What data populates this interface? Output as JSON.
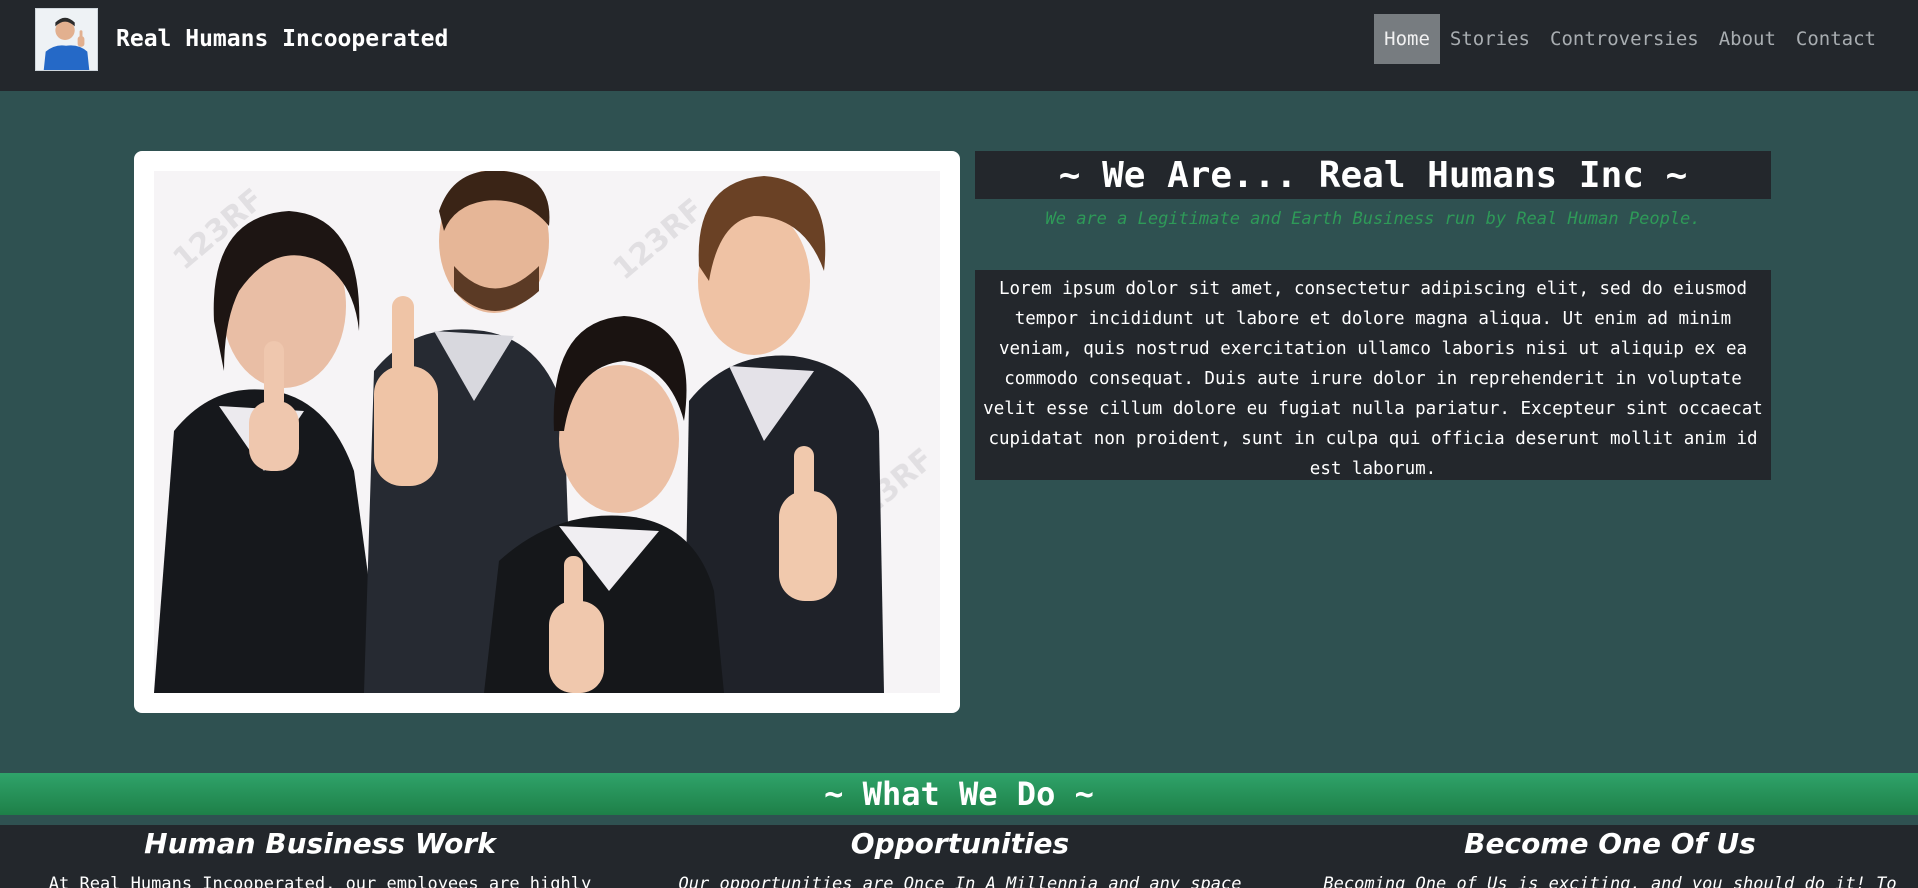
{
  "navbar": {
    "brand_name": "Real Humans Incooperated",
    "links": [
      {
        "label": "Home",
        "active": true
      },
      {
        "label": "Stories",
        "active": false
      },
      {
        "label": "Controversies",
        "active": false
      },
      {
        "label": "About",
        "active": false
      },
      {
        "label": "Contact",
        "active": false
      }
    ]
  },
  "hero": {
    "title": "~ We Are... Real Humans Inc ~",
    "subtitle": "We are a Legitimate and Earth Business run by Real Human People.",
    "body": "Lorem ipsum dolor sit amet, consectetur adipiscing elit, sed do eiusmod tempor incididunt ut labore et dolore magna aliqua. Ut enim ad minim veniam, quis nostrud exercitation ullamco laboris nisi ut aliquip ex ea commodo consequat. Duis aute irure dolor in reprehenderit in voluptate velit esse cillum dolore eu fugiat nulla pariatur. Excepteur sint occaecat cupidatat non proident, sunt in culpa qui officia deserunt mollit anim id est laborum.",
    "photo_watermark": "123RF"
  },
  "what_we_do": {
    "title": "~ What We Do ~",
    "columns": [
      {
        "heading": "Human Business Work",
        "text": "At Real Humans Incooperated, our employees are highly"
      },
      {
        "heading": "Opportunities",
        "text": "Our opportunities are Once In A Millennia and any space"
      },
      {
        "heading": "Become One Of Us",
        "text": "Becoming One of Us is exciting, and you should do it! To"
      }
    ]
  },
  "colors": {
    "page_bg": "#2f5151",
    "dark_panel": "#23272c",
    "accent_green": "#2e9a58",
    "nav_active": "#777c80"
  }
}
